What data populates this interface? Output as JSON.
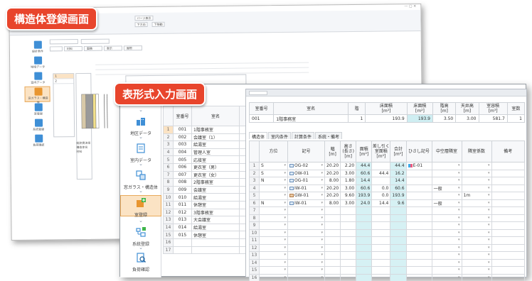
{
  "labels": {
    "back_title": "構造体登録画面",
    "front_title": "表形式入力画面"
  },
  "back_window": {
    "ribbon_buttons": [
      "パーツ表示",
      "下方向",
      "下移動"
    ],
    "toolbar": [
      "材料",
      "面積",
      "表示",
      "屋根"
    ],
    "nav_items": [
      "設計条件",
      "地域データ",
      "室内データ",
      "窓ガラス・構造体",
      "室登録",
      "系統登録",
      "負荷確認"
    ],
    "grid_rows": [
      "1",
      "2"
    ],
    "info": [
      "総熱貫流率",
      "構造体名",
      "材料"
    ]
  },
  "front_nav": {
    "items": [
      {
        "label": "地区データ",
        "icon": "region-data-icon"
      },
      {
        "label": "室内データ",
        "icon": "indoor-data-icon"
      },
      {
        "label": "窓ガラス・構造体",
        "icon": "window-structure-icon"
      },
      {
        "label": "室登録",
        "icon": "room-register-icon",
        "active": true
      },
      {
        "label": "系統登録",
        "icon": "system-register-icon"
      },
      {
        "label": "負荷確認",
        "icon": "load-check-icon"
      }
    ]
  },
  "room_table": {
    "headers": [
      "室番号",
      "室名",
      "階"
    ],
    "rows": [
      {
        "n": "1",
        "code": "001",
        "name": "1階事務室",
        "floor": "1",
        "sel": true
      },
      {
        "n": "2",
        "code": "002",
        "name": "会議室（1）",
        "floor": "1"
      },
      {
        "n": "3",
        "code": "003",
        "name": "給湯室",
        "floor": "1"
      },
      {
        "n": "4",
        "code": "004",
        "name": "管理人室",
        "floor": "1"
      },
      {
        "n": "5",
        "code": "005",
        "name": "応接室",
        "floor": "1"
      },
      {
        "n": "6",
        "code": "006",
        "name": "更衣室（男）",
        "floor": "1"
      },
      {
        "n": "7",
        "code": "007",
        "name": "更衣室（女）",
        "floor": "1"
      },
      {
        "n": "8",
        "code": "008",
        "name": "2階事務室",
        "floor": "2"
      },
      {
        "n": "9",
        "code": "009",
        "name": "会議室",
        "floor": "2"
      },
      {
        "n": "10",
        "code": "010",
        "name": "給湯室",
        "floor": "2"
      },
      {
        "n": "11",
        "code": "011",
        "name": "休憩室",
        "floor": "2"
      },
      {
        "n": "12",
        "code": "012",
        "name": "3階事務室",
        "floor": "3"
      },
      {
        "n": "13",
        "code": "013",
        "name": "大会議室",
        "floor": "3"
      },
      {
        "n": "14",
        "code": "014",
        "name": "給湯室",
        "floor": "3"
      },
      {
        "n": "15",
        "code": "015",
        "name": "休憩室",
        "floor": "3"
      },
      {
        "n": "16",
        "code": "",
        "name": "",
        "floor": ""
      },
      {
        "n": "17",
        "code": "",
        "name": "",
        "floor": ""
      }
    ]
  },
  "summary": {
    "headers": [
      "室番号",
      "室名",
      "階",
      "床面積\n[m²]",
      "床面積\n[m²]",
      "階高\n[m]",
      "天井高\n[m]",
      "室容積\n[m³]",
      "室数"
    ],
    "row": [
      "001",
      "1階事務室",
      "1",
      "193.9",
      "193.9",
      "3.50",
      "3.00",
      "581.7",
      "1"
    ]
  },
  "tabs": [
    "構造体",
    "室内条件",
    "計算条件",
    "系統・備考"
  ],
  "grid": {
    "headers": [
      "方位",
      "記号",
      "幅\n[m]",
      "高さ\n(長さ)\n[m]",
      "面積\n[m²]",
      "差し引く\n室面積\n[m²]",
      "合計\n[m²]",
      "ひさし記号",
      "中空層隣室",
      "隣室係数",
      "備考"
    ],
    "rows": [
      {
        "n": "1",
        "dir": "S",
        "code": "OG-02",
        "icon": "glass",
        "w": "20.20",
        "h": "2.20",
        "area": "44.4",
        "sub": "",
        "total": "44.4",
        "eave": "E-01",
        "adj": "",
        "coef": ""
      },
      {
        "n": "2",
        "dir": "S",
        "code": "OW-01",
        "icon": "wall",
        "w": "20.20",
        "h": "3.00",
        "area": "60.6",
        "sub": "44.4",
        "total": "16.2",
        "eave": "",
        "adj": "",
        "coef": ""
      },
      {
        "n": "3",
        "dir": "N",
        "code": "OG-01",
        "icon": "glass",
        "w": "8.00",
        "h": "1.80",
        "area": "14.4",
        "sub": "",
        "total": "14.4",
        "eave": "",
        "adj": "",
        "coef": ""
      },
      {
        "n": "4",
        "dir": "",
        "code": "IW-01",
        "icon": "wall",
        "w": "20.20",
        "h": "3.00",
        "area": "60.6",
        "sub": "0.0",
        "total": "60.6",
        "eave": "",
        "adj": "一般",
        "coef": ""
      },
      {
        "n": "5",
        "dir": "",
        "code": "GW-01",
        "icon": "brick",
        "w": "20.20",
        "h": "9.60",
        "area": "193.9",
        "sub": "0.0",
        "total": "193.9",
        "eave": "",
        "adj": "",
        "coef": "1m"
      },
      {
        "n": "6",
        "dir": "N",
        "code": "IW-01",
        "icon": "wall",
        "w": "8.00",
        "h": "3.00",
        "area": "24.0",
        "sub": "14.4",
        "total": "9.6",
        "eave": "",
        "adj": "一般",
        "coef": ""
      },
      {
        "n": "7"
      },
      {
        "n": "8"
      },
      {
        "n": "9"
      },
      {
        "n": "10"
      },
      {
        "n": "11"
      },
      {
        "n": "12"
      },
      {
        "n": "13"
      },
      {
        "n": "14"
      },
      {
        "n": "15"
      },
      {
        "n": "16"
      },
      {
        "n": "17"
      }
    ]
  },
  "colors": {
    "accent": "#e8452c",
    "highlight": "#d6f1f4",
    "selected": "#fbe3c4"
  }
}
